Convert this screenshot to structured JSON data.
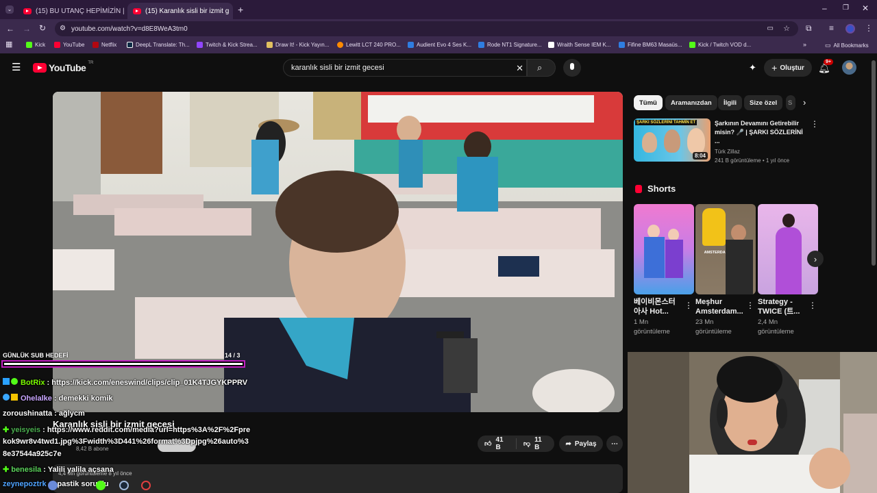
{
  "tabs": [
    {
      "title": "(15) BU UTANÇ HEPİMİZİN | Ma",
      "active": false
    },
    {
      "title": "(15) Karanlık sisli bir izmit g",
      "active": true
    }
  ],
  "url": "youtube.com/watch?v=d8E8WeA3tm0",
  "bookmarks": [
    "Kick",
    "YouTube",
    "Netflix",
    "DeepL Translate: Th...",
    "Twitch & Kick Strea...",
    "Draw It! - Kick Yayın...",
    "Lewitt LCT 240 PRO...",
    "Audient Evo 4 Ses K...",
    "Rode NT1 Signature...",
    "Wraith Sense IEM K...",
    "Fifine BM63 Masaüs...",
    "Kick / Twitch VOD d..."
  ],
  "all_bookmarks": "All Bookmarks",
  "youtube": {
    "logo": "YouTube",
    "region": "TR",
    "search_query": "karanlık sisli bir izmit gecesi",
    "create_label": "Oluştur",
    "notif_count": "9+"
  },
  "chips": [
    "Tümü",
    "Aramanızdan",
    "İlgili",
    "Size özel",
    "S"
  ],
  "recommended": {
    "thumb_text": "ŞARKI SÖZLERİNİ  TAHMİN ET",
    "title": "Şarkının Devamını Getirebilir misin? 🎤 | ŞARKI SÖZLERİNİ ...",
    "channel": "Türk Zillaz",
    "meta": "241 B görüntüleme • 1 yıl önce",
    "duration": "8:04"
  },
  "shorts_label": "Shorts",
  "shorts": [
    {
      "title": "베이비몬스터 아사 Hot...",
      "views": "1 Mn",
      "views_label": "görüntüleme"
    },
    {
      "title": "Meşhur Amsterdam...",
      "views": "23 Mn",
      "views_label": "görüntüleme",
      "thumb_text": "AMSTERDAM PATATESİ"
    },
    {
      "title": "Strategy - TWICE (트...",
      "views": "2,4 Mn",
      "views_label": "görüntüleme"
    }
  ],
  "video": {
    "title": "Karanlık sisli bir izmit gecesi",
    "subscribers": "8,42 B abone",
    "views_date": "4,4 Mn görüntüleme  8 yıl önce",
    "likes": "41 B",
    "dislikes": "11 B",
    "share": "Paylaş"
  },
  "overlay": {
    "goal_label": "GÜNLÜK SUB HEDEFİ",
    "goal_count": "14 / 3",
    "goal_progress": 1.0
  },
  "chat": [
    {
      "user": "BotRix",
      "message": "https://kick.com/eneswind/clips/clip_01K4TJGYKPPRV",
      "color": "#7cfc00"
    },
    {
      "user": "Ohelalke",
      "message": "demekki komik",
      "color": "#c9a6ff"
    },
    {
      "user": "zoroushinatta",
      "message": "ağlycm",
      "color": "#ffffff"
    },
    {
      "user": "yeisyeis",
      "message": "https://www.reddit.com/media?url=https%3A%2F%2Fpre",
      "color": "#4caf50"
    },
    {
      "line": "kok9wr8v4twd1.jpg%3Fwidth%3D441%26format%3Dpjpg%26auto%3"
    },
    {
      "line": "8e37544a925c7e"
    },
    {
      "user": "benesila",
      "message": "Yalili yalila açsana",
      "color": "#5bd35b"
    },
    {
      "user": "zeynepoztrk",
      "message": "spastik sorunlu",
      "color": "#4fa3ff"
    }
  ],
  "colors": {
    "brand_red": "#ff0033",
    "kick_green": "#53fc18",
    "bg": "#0f0f0f"
  }
}
